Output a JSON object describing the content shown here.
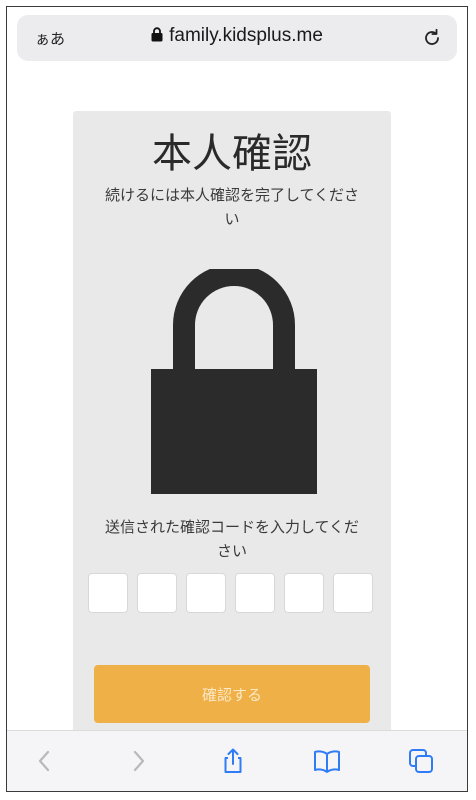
{
  "browser": {
    "aa_label": "ぁあ",
    "url": "family.kidsplus.me"
  },
  "card": {
    "title": "本人確認",
    "subtitle": "続けるには本人確認を完了してください",
    "instruction": "送信された確認コードを入力してください",
    "code_digits": [
      "",
      "",
      "",
      "",
      "",
      ""
    ],
    "confirm_label": "確認する"
  },
  "toolbar": {
    "icons": [
      "back-icon",
      "forward-icon",
      "share-icon",
      "bookmarks-icon",
      "tabs-icon"
    ]
  },
  "colors": {
    "accent": "#efb047",
    "card_bg": "#e9e9ea",
    "lock": "#2b2b2b",
    "ios_blue": "#2f7cf6"
  }
}
